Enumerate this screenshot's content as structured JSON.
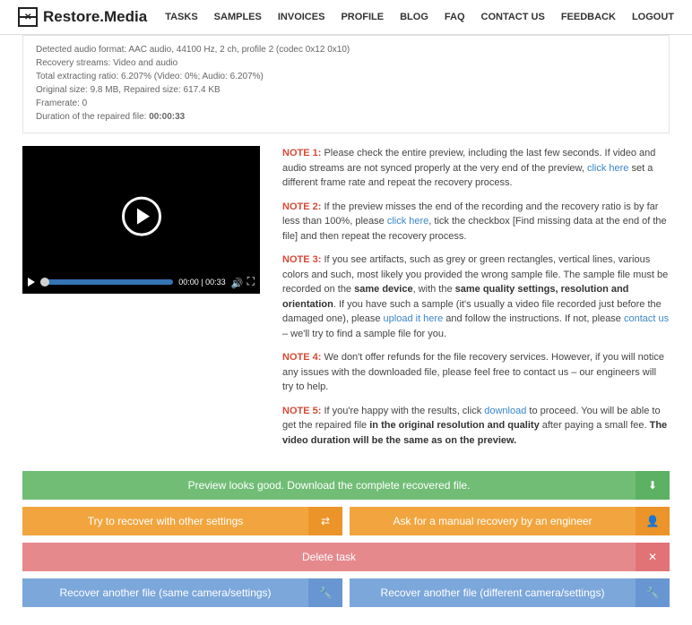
{
  "brand": "Restore.Media",
  "nav": [
    "TASKS",
    "SAMPLES",
    "INVOICES",
    "PROFILE",
    "BLOG",
    "FAQ",
    "CONTACT US",
    "FEEDBACK",
    "LOGOUT"
  ],
  "meta": {
    "l1": "Detected audio format: AAC audio, 44100 Hz, 2 ch, profile 2 (codec 0x12 0x10)",
    "l2": "Recovery streams: Video and audio",
    "l3": "Total extracting ratio: 6.207% (Video: 0%; Audio: 6.207%)",
    "l4": "Original size: 9.8 MB, Repaired size: 617.4 KB",
    "l5": "Framerate: 0",
    "l6a": "Duration of the repaired file: ",
    "l6b": "00:00:33"
  },
  "player": {
    "time": "00:00 | 00:33"
  },
  "notes": {
    "n1": {
      "b": "NOTE 1:",
      "t1": " Please check the entire preview, including the last few seconds. If video and audio streams are not synced properly at the very end of the preview, ",
      "link": "click here",
      "t2": " set a different frame rate and repeat the recovery process."
    },
    "n2": {
      "b": "NOTE 2:",
      "t1": " If the preview misses the end of the recording and the recovery ratio is by far less than 100%, please ",
      "link": "click here",
      "t2": ", tick the checkbox [Find missing data at the end of the file] and then repeat the recovery process."
    },
    "n3": {
      "b": "NOTE 3:",
      "t1": " If you see artifacts, such as grey or green rectangles, vertical lines, various colors and such, most likely you provided the wrong sample file. The sample file must be recorded on the ",
      "s1": "same device",
      "t2": ", with the ",
      "s2": "same quality settings, resolution and orientation",
      "t3": ". If you have such a sample (it's usually a video file recorded just before the damaged one), please ",
      "link1": "upload it here",
      "t4": " and follow the instructions. If not, please ",
      "link2": "contact us",
      "t5": " – we'll try to find a sample file for you."
    },
    "n4": {
      "b": "NOTE 4:",
      "t": " We don't offer refunds for the file recovery services. However, if you will notice any issues with the downloaded file, please feel free to contact us – our engineers will try to help."
    },
    "n5": {
      "b": "NOTE 5:",
      "t1": " If you're happy with the results, click ",
      "link": "download",
      "t2": " to proceed. You will be able to get the repaired file ",
      "s1": "in the original resolution and quality",
      "t3": " after paying a small fee. ",
      "s2": "The video duration will be the same as on the preview."
    }
  },
  "buttons": {
    "download": "Preview looks good. Download the complete recovered file.",
    "retry": "Try to recover with other settings",
    "manual": "Ask for a manual recovery by an engineer",
    "delete": "Delete task",
    "same": "Recover another file (same camera/settings)",
    "diff": "Recover another file (different camera/settings)"
  }
}
